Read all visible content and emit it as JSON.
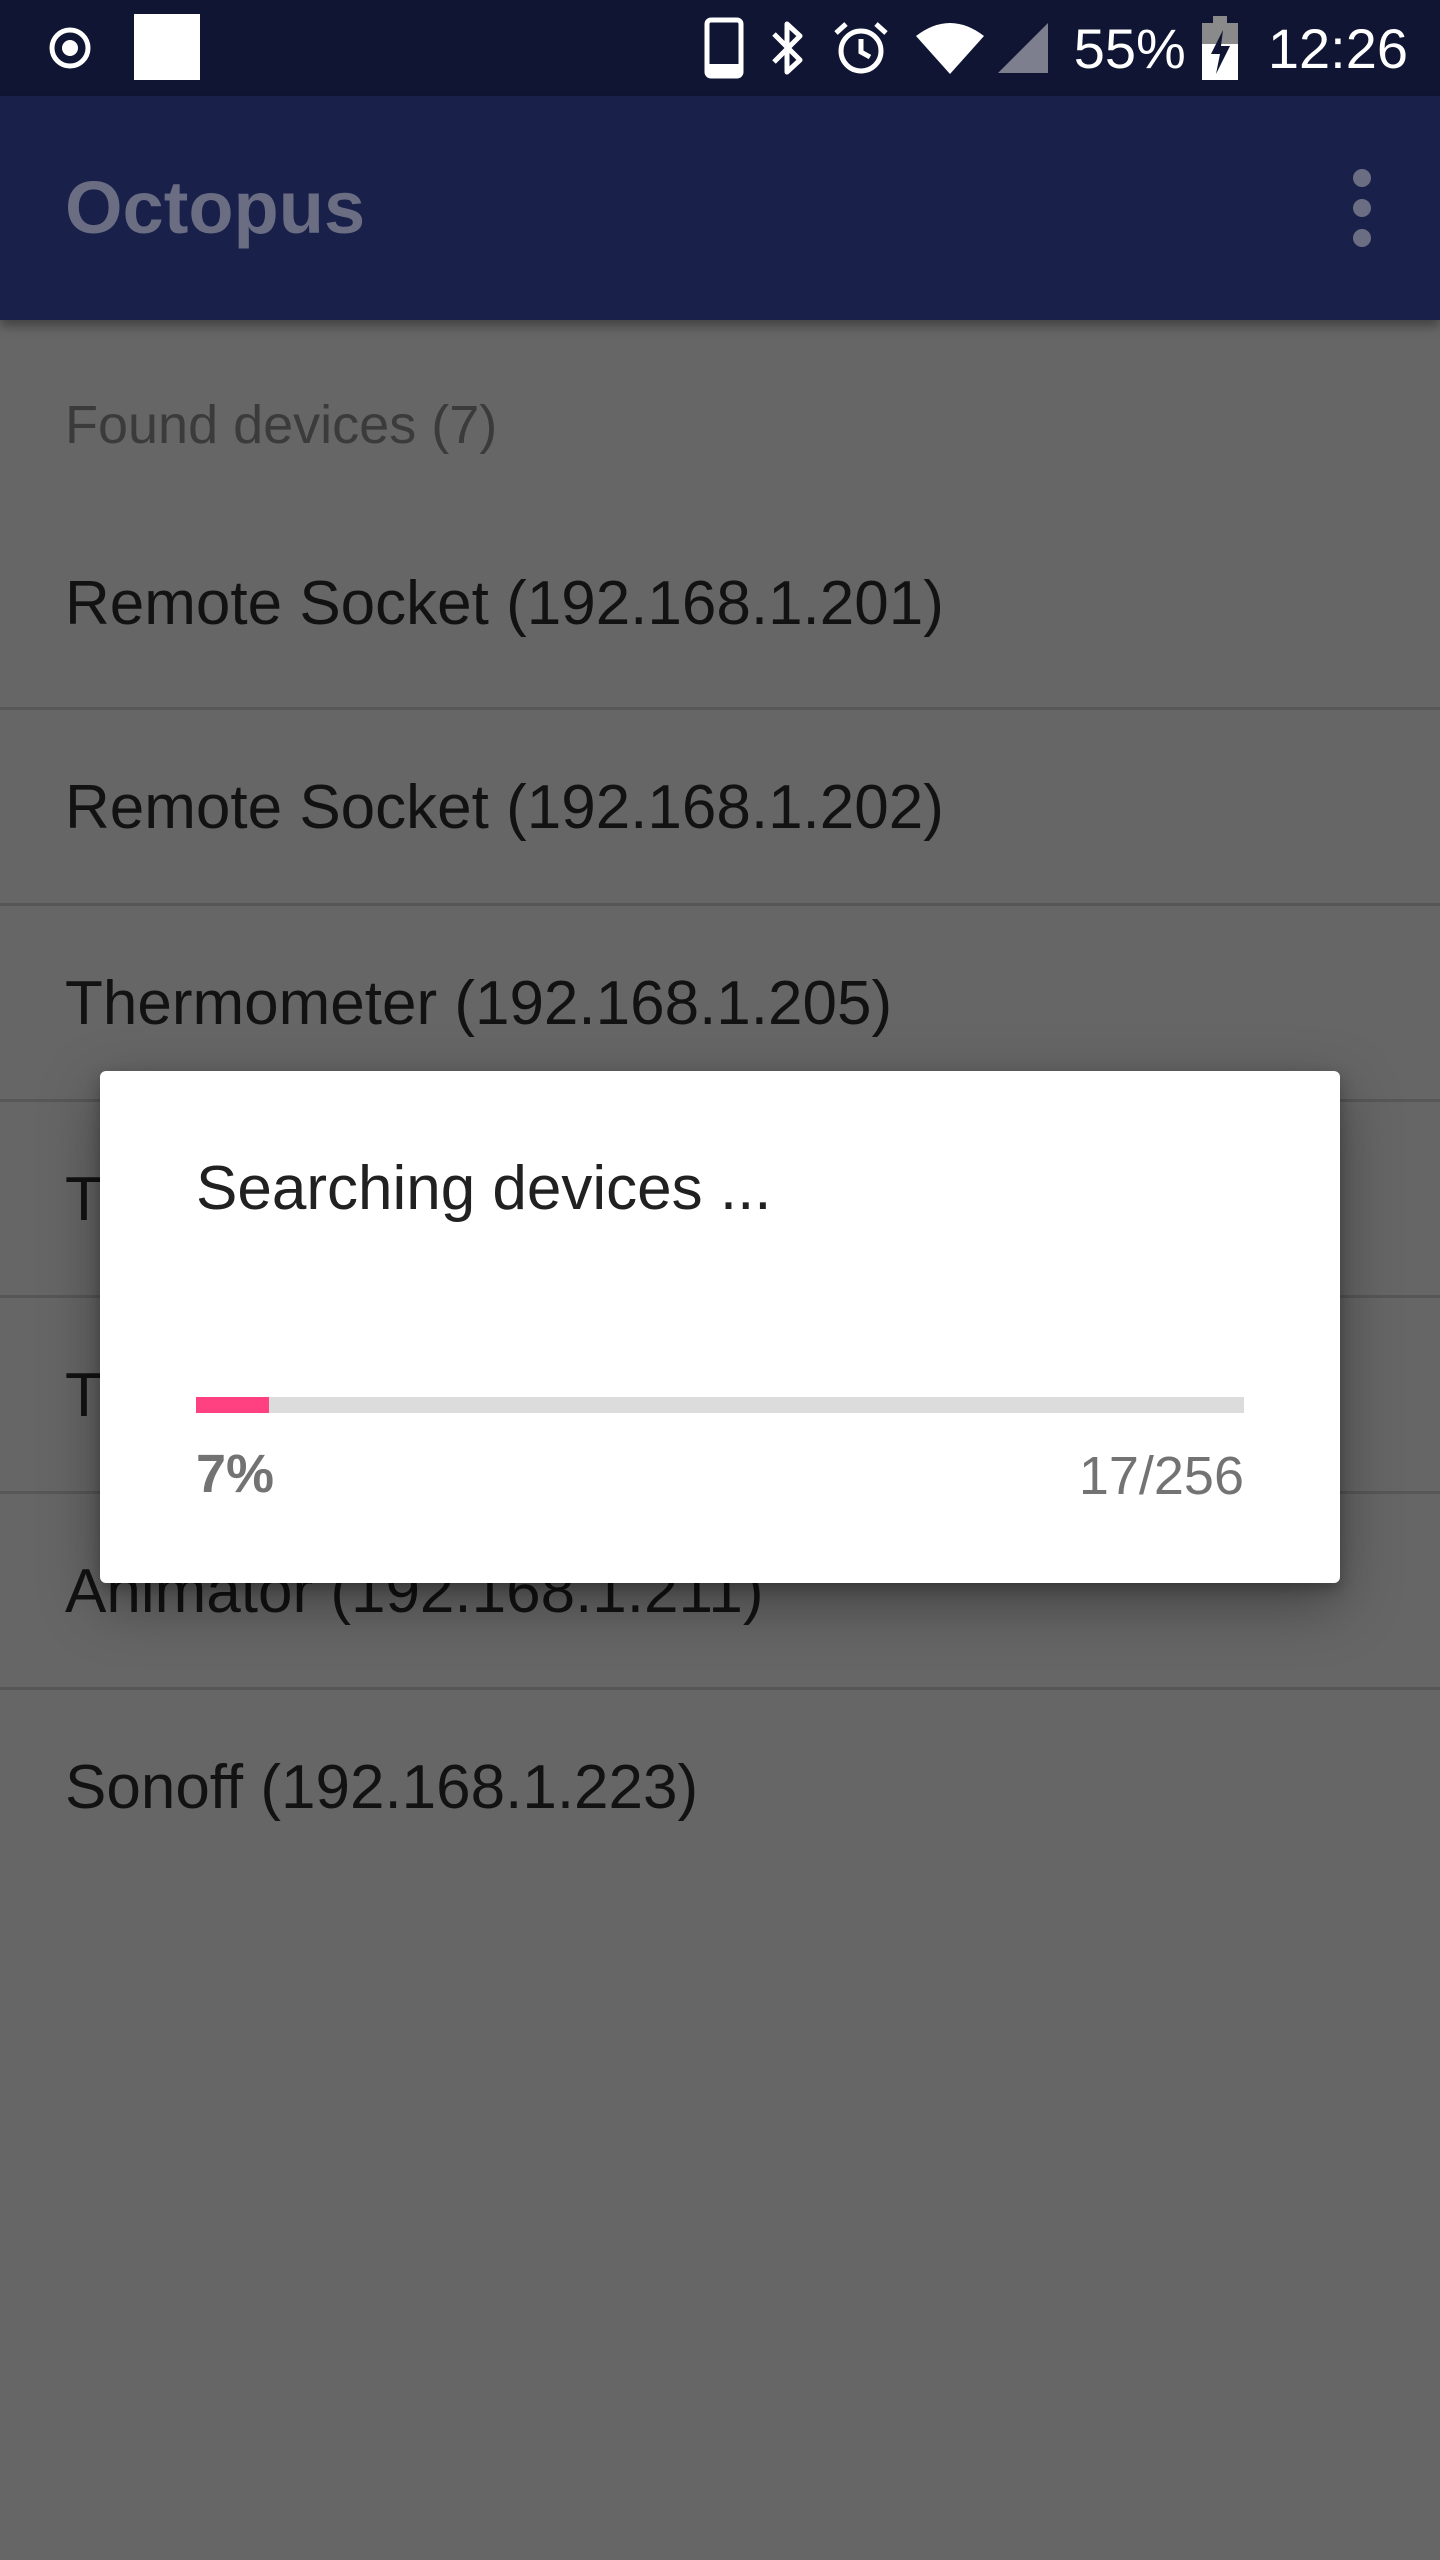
{
  "status_bar": {
    "battery": "55%",
    "time": "12:26",
    "icons": [
      "target-icon",
      "notification-square-icon",
      "phone-icon",
      "bluetooth-icon",
      "alarm-icon",
      "wifi-icon",
      "signal-icon",
      "battery-charging-icon"
    ]
  },
  "app_bar": {
    "title": "Octopus",
    "menu_icon": "more-vert-icon"
  },
  "list": {
    "header": "Found devices (7)",
    "devices": [
      "Remote Socket (192.168.1.201)",
      "Remote Socket (192.168.1.202)",
      "Thermometer (192.168.1.205)",
      "T",
      "T",
      "Animator (192.168.1.211)",
      "Sonoff (192.168.1.223)"
    ]
  },
  "dialog": {
    "title": "Searching devices ...",
    "progress_fraction": 0.07,
    "percent_label": "7%",
    "count_label": "17/256"
  },
  "colors": {
    "status_bar": "#0f1532",
    "app_bar": "#19204a",
    "accent": "#ff4081",
    "scrim_background": "#666666"
  }
}
